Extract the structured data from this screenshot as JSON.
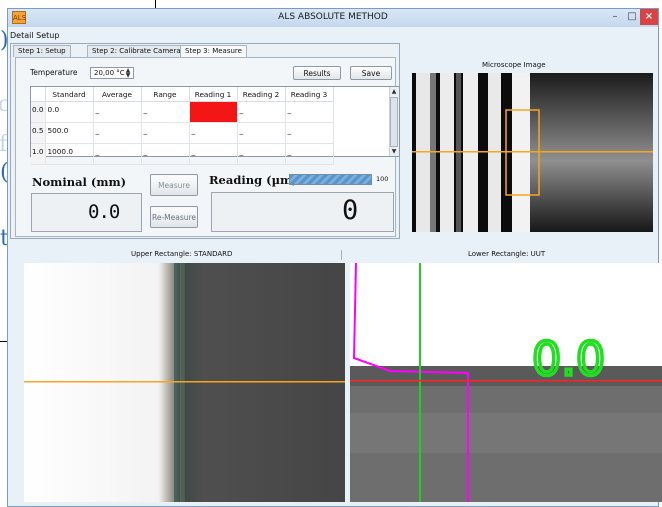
{
  "window": {
    "title": "ALS ABSOLUTE METHOD",
    "controls": {
      "minimize": "–",
      "maximize": "□",
      "close": "×"
    }
  },
  "menu": {
    "detail_setup": "Detail Setup"
  },
  "tabs": [
    {
      "label": "Step 1: Setup"
    },
    {
      "label": "Step 2: Calibrate Camera"
    },
    {
      "label": "Step 3: Measure",
      "active": true
    }
  ],
  "temperature": {
    "label": "Temperature",
    "value": "20,00 °C"
  },
  "buttons": {
    "results": "Results",
    "save": "Save",
    "measure": "Measure",
    "remeasure": "Re-Measure"
  },
  "table": {
    "columns": [
      "Standard",
      "Average",
      "Range",
      "Reading 1",
      "Reading 2",
      "Reading 3"
    ],
    "rows": [
      {
        "row_head": "0.0",
        "standard": "0.0",
        "average": "_",
        "range": "_",
        "reading1": "",
        "reading2": "_",
        "reading3": "_"
      },
      {
        "row_head": "0.5",
        "standard": "500.0",
        "average": "_",
        "range": "_",
        "reading1": "_",
        "reading2": "_",
        "reading3": "_"
      },
      {
        "row_head": "1.0",
        "standard": "1000.0",
        "average": "_",
        "range": "_",
        "reading1": "_",
        "reading2": "_",
        "reading3": "_"
      }
    ],
    "highlight_color": "#f21616"
  },
  "nominal": {
    "label": "Nominal (mm)",
    "value": "0.0"
  },
  "reading": {
    "label": "Reading  (µm)",
    "value": "0",
    "progress_max": "100",
    "progress_fraction": 1.0
  },
  "microscope": {
    "label": "Microscope Image",
    "roi_color": "#f5a623",
    "crosshair_color": "#f5a623"
  },
  "upper_rect": {
    "label": "Upper Rectangle: STANDARD",
    "line_color": "#f5a623"
  },
  "lower_rect": {
    "label": "Lower Rectangle: UUT",
    "overlay_text": "0.0",
    "overlay_color": "#22dd22",
    "edge_color": "#ff00ff",
    "line_color": "#ff2222"
  },
  "background": {
    "chars": [
      ")",
      "c",
      "f",
      "(",
      "t"
    ]
  }
}
